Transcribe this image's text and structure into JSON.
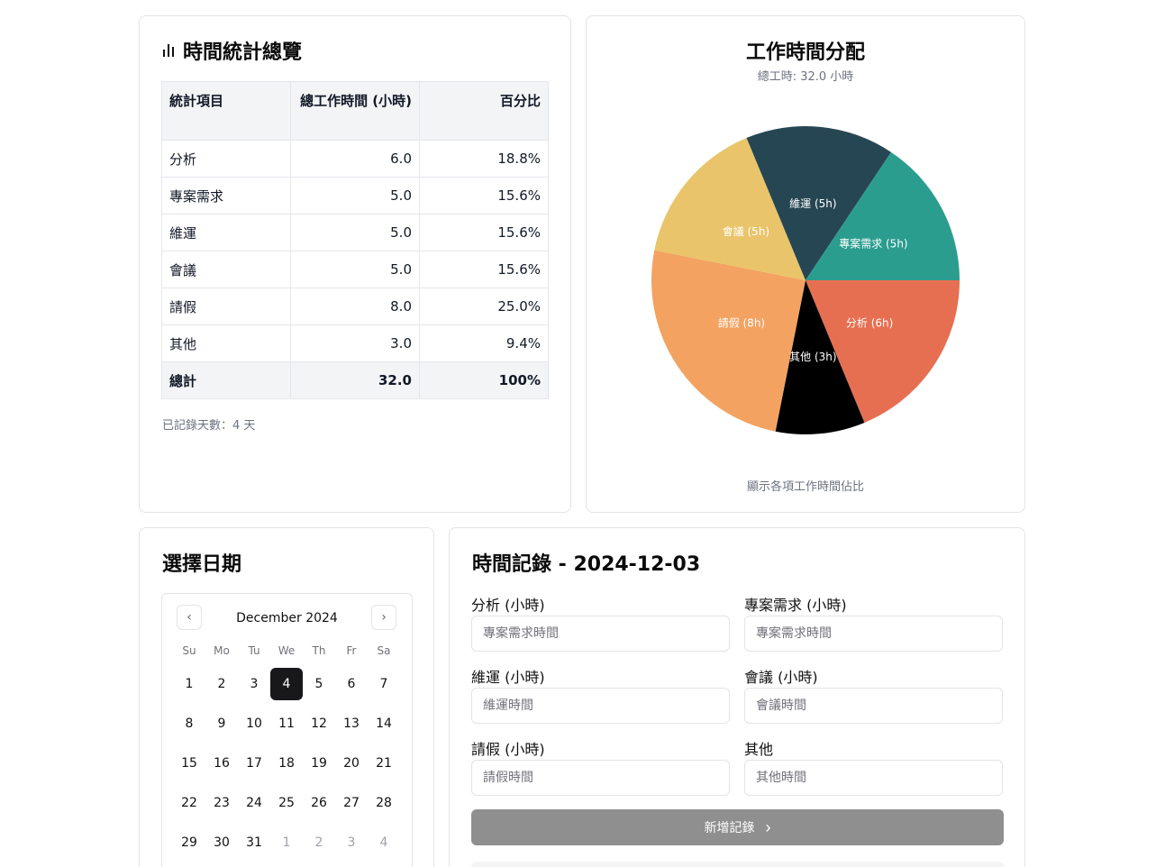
{
  "stats": {
    "title": "時間統計總覽",
    "headers": [
      "統計項目",
      "總工作時間 (小時)",
      "百分比"
    ],
    "rows": [
      {
        "item": "分析",
        "hours": "6.0",
        "pct": "18.8%"
      },
      {
        "item": "專案需求",
        "hours": "5.0",
        "pct": "15.6%"
      },
      {
        "item": "維運",
        "hours": "5.0",
        "pct": "15.6%"
      },
      {
        "item": "會議",
        "hours": "5.0",
        "pct": "15.6%"
      },
      {
        "item": "請假",
        "hours": "8.0",
        "pct": "25.0%"
      },
      {
        "item": "其他",
        "hours": "3.0",
        "pct": "9.4%"
      }
    ],
    "total": {
      "item": "總計",
      "hours": "32.0",
      "pct": "100%"
    },
    "days_text": "已記錄天數：4 天"
  },
  "chart": {
    "subtitle": "總工時: 32.0 小時",
    "caption": "顯示各項工作時間佔比"
  },
  "chart_data": {
    "type": "pie",
    "title": "工作時間分配",
    "slices": [
      {
        "label": "分析 (6h)",
        "value": 6,
        "color": "#e76f51"
      },
      {
        "label": "其他 (3h)",
        "value": 3,
        "color": "#000000"
      },
      {
        "label": "請假 (8h)",
        "value": 8,
        "color": "#f4a261"
      },
      {
        "label": "會議 (5h)",
        "value": 5,
        "color": "#e9c46a"
      },
      {
        "label": "維運 (5h)",
        "value": 5,
        "color": "#264653"
      },
      {
        "label": "專案需求 (5h)",
        "value": 5,
        "color": "#2a9d8f"
      }
    ]
  },
  "date_picker": {
    "title": "選擇日期",
    "month_label": "December 2024",
    "weekdays": [
      "Su",
      "Mo",
      "Tu",
      "We",
      "Th",
      "Fr",
      "Sa"
    ],
    "days": [
      {
        "d": "1"
      },
      {
        "d": "2"
      },
      {
        "d": "3"
      },
      {
        "d": "4",
        "selected": true
      },
      {
        "d": "5"
      },
      {
        "d": "6"
      },
      {
        "d": "7"
      },
      {
        "d": "8"
      },
      {
        "d": "9"
      },
      {
        "d": "10"
      },
      {
        "d": "11"
      },
      {
        "d": "12"
      },
      {
        "d": "13"
      },
      {
        "d": "14"
      },
      {
        "d": "15"
      },
      {
        "d": "16"
      },
      {
        "d": "17"
      },
      {
        "d": "18"
      },
      {
        "d": "19"
      },
      {
        "d": "20"
      },
      {
        "d": "21"
      },
      {
        "d": "22"
      },
      {
        "d": "23"
      },
      {
        "d": "24"
      },
      {
        "d": "25"
      },
      {
        "d": "26"
      },
      {
        "d": "27"
      },
      {
        "d": "28"
      },
      {
        "d": "29"
      },
      {
        "d": "30"
      },
      {
        "d": "31"
      },
      {
        "d": "1",
        "outside": true
      },
      {
        "d": "2",
        "outside": true
      },
      {
        "d": "3",
        "outside": true
      },
      {
        "d": "4",
        "outside": true
      }
    ]
  },
  "form": {
    "title": "時間記錄 - 2024-12-03",
    "fields": [
      {
        "label": "分析 (小時)",
        "placeholder": "專案需求時間"
      },
      {
        "label": "專案需求 (小時)",
        "placeholder": "專案需求時間"
      },
      {
        "label": "維運 (小時)",
        "placeholder": "維運時間"
      },
      {
        "label": "會議 (小時)",
        "placeholder": "會議時間"
      },
      {
        "label": "請假 (小時)",
        "placeholder": "請假時間"
      },
      {
        "label": "其他",
        "placeholder": "其他時間"
      }
    ],
    "submit_label": "新增記錄"
  }
}
